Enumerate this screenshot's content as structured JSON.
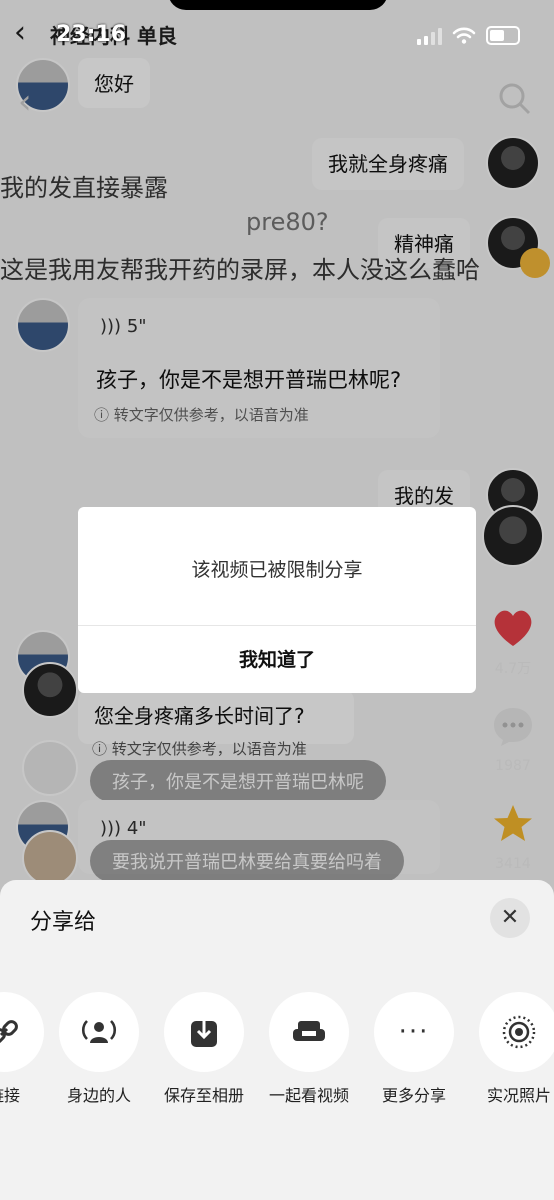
{
  "status": {
    "time": "23:16"
  },
  "header": {
    "title": "神经内科 单良"
  },
  "messages": {
    "hello": "您好",
    "pain": "我就全身疼痛",
    "pre80": "pre80?",
    "mental": "精神痛",
    "my_hair": "我的发",
    "voice1_len": "5\"",
    "voice1_text": "孩子，你是不是想开普瑞巴林呢?",
    "voice_note": "转文字仅供参考，以语音为准",
    "how_long": "您全身疼痛多长时间了?",
    "voice2_len": "4\"",
    "voice2_text": "只要我说开普瑞巴林要给真要吃胃吗着"
  },
  "captions": {
    "line1": "我的发直接暴露",
    "line2": "这是我用友帮我开药的录屏，本人没这么蠢哈"
  },
  "side": {
    "likes": "4.7万",
    "comments": "1987",
    "favs": "3414"
  },
  "comments": {
    "c1": "孩子，你是不是想开普瑞巴林呢",
    "c2": "要我说开普瑞巴林要给真要给吗着"
  },
  "modal": {
    "message": "该视频已被限制分享",
    "button": "我知道了"
  },
  "share": {
    "title": "分享给",
    "items": [
      {
        "label": "链接",
        "icon": "link-icon"
      },
      {
        "label": "身边的人",
        "icon": "nearby-people-icon"
      },
      {
        "label": "保存至相册",
        "icon": "save-icon"
      },
      {
        "label": "一起看视频",
        "icon": "sofa-icon"
      },
      {
        "label": "更多分享",
        "icon": "more-icon"
      },
      {
        "label": "实况照片",
        "icon": "live-photo-icon"
      }
    ]
  }
}
